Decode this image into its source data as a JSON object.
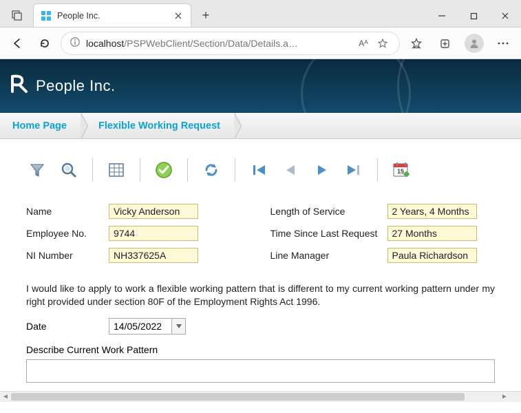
{
  "window": {
    "tab_title": "People Inc.",
    "win_min": "—",
    "win_max": "□",
    "win_close": "✕",
    "newtab": "+"
  },
  "address": {
    "host": "localhost",
    "path": "/PSPWebClient/Section/Data/Details.a…",
    "read_aloud": "Aᴬ"
  },
  "brand": "People Inc.",
  "breadcrumb": {
    "home": "Home Page",
    "current": "Flexible Working Request"
  },
  "labels": {
    "name": "Name",
    "employee_no": "Employee No.",
    "ni": "NI Number",
    "los": "Length of Service",
    "tslr": "Time Since Last Request",
    "manager": "Line Manager",
    "date": "Date",
    "describe": "Describe Current Work Pattern"
  },
  "values": {
    "name": "Vicky Anderson",
    "employee_no": "9744",
    "ni": "NH337625A",
    "los": "2 Years, 4 Months",
    "tslr": "27 Months",
    "manager": "Paula Richardson",
    "date": "14/05/2022"
  },
  "paragraph": "I would like to apply to work a flexible working pattern that is different to my current working pattern under my right provided under section 80F of the Employment Rights Act 1996."
}
